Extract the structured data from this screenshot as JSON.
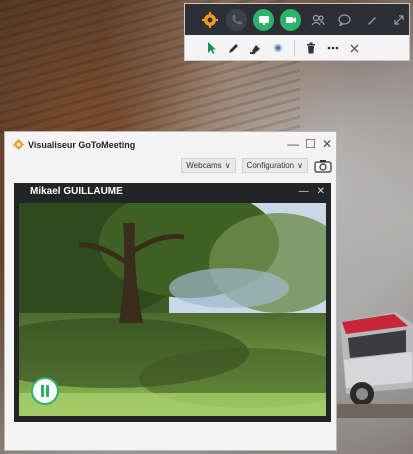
{
  "viewer": {
    "title": "Visualiseur GoToMeeting",
    "webcams_label": "Webcams",
    "config_label": "Configuration"
  },
  "webcam": {
    "participant_name": "Mikael GUILLAUME"
  },
  "toolbar": {
    "top_icons": [
      "gotomeeting-logo-icon",
      "phone-icon",
      "screen-share-icon",
      "webcam-icon",
      "people-icon",
      "chat-icon",
      "pen-icon",
      "expand-icon"
    ],
    "bottom_icons": [
      "pointer-icon",
      "pencil-icon",
      "highlighter-icon",
      "spotlight-icon",
      "trash-icon",
      "more-icon",
      "close-icon"
    ]
  },
  "colors": {
    "accent_green": "#2bb36c",
    "toolbar_dark": "#2c2f33",
    "logo_orange": "#f39a1f"
  }
}
